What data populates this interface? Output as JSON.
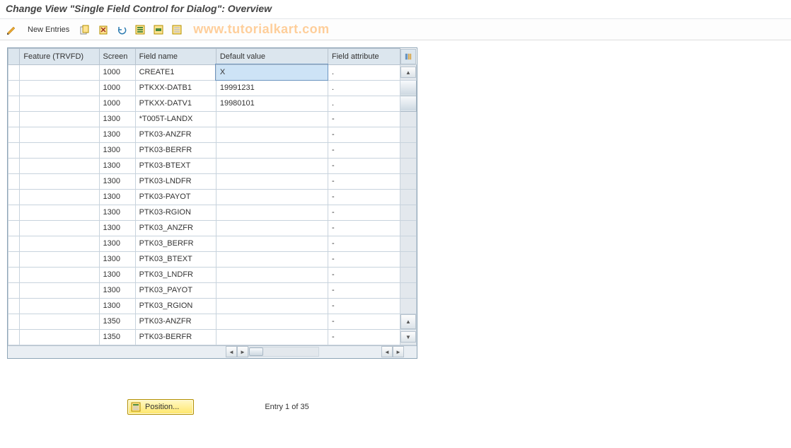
{
  "title": "Change View \"Single Field Control for Dialog\": Overview",
  "watermark": "www.tutorialkart.com",
  "toolbar": {
    "new_entries": "New Entries"
  },
  "columns": {
    "feature": "Feature (TRVFD)",
    "screen": "Screen",
    "field_name": "Field name",
    "default_value": "Default value",
    "field_attr": "Field attribute"
  },
  "rows": [
    {
      "feature": "",
      "screen": "1000",
      "field_name": "CREATE1",
      "default": "X",
      "attr": "."
    },
    {
      "feature": "",
      "screen": "1000",
      "field_name": "PTKXX-DATB1",
      "default": "19991231",
      "attr": "."
    },
    {
      "feature": "",
      "screen": "1000",
      "field_name": "PTKXX-DATV1",
      "default": "19980101",
      "attr": "."
    },
    {
      "feature": "",
      "screen": "1300",
      "field_name": "*T005T-LANDX",
      "default": "",
      "attr": "-"
    },
    {
      "feature": "",
      "screen": "1300",
      "field_name": "PTK03-ANZFR",
      "default": "",
      "attr": "-"
    },
    {
      "feature": "",
      "screen": "1300",
      "field_name": "PTK03-BERFR",
      "default": "",
      "attr": "-"
    },
    {
      "feature": "",
      "screen": "1300",
      "field_name": "PTK03-BTEXT",
      "default": "",
      "attr": "-"
    },
    {
      "feature": "",
      "screen": "1300",
      "field_name": "PTK03-LNDFR",
      "default": "",
      "attr": "-"
    },
    {
      "feature": "",
      "screen": "1300",
      "field_name": "PTK03-PAYOT",
      "default": "",
      "attr": "-"
    },
    {
      "feature": "",
      "screen": "1300",
      "field_name": "PTK03-RGION",
      "default": "",
      "attr": "-"
    },
    {
      "feature": "",
      "screen": "1300",
      "field_name": "PTK03_ANZFR",
      "default": "",
      "attr": "-"
    },
    {
      "feature": "",
      "screen": "1300",
      "field_name": "PTK03_BERFR",
      "default": "",
      "attr": "-"
    },
    {
      "feature": "",
      "screen": "1300",
      "field_name": "PTK03_BTEXT",
      "default": "",
      "attr": "-"
    },
    {
      "feature": "",
      "screen": "1300",
      "field_name": "PTK03_LNDFR",
      "default": "",
      "attr": "-"
    },
    {
      "feature": "",
      "screen": "1300",
      "field_name": "PTK03_PAYOT",
      "default": "",
      "attr": "-"
    },
    {
      "feature": "",
      "screen": "1300",
      "field_name": "PTK03_RGION",
      "default": "",
      "attr": "-"
    },
    {
      "feature": "",
      "screen": "1350",
      "field_name": "PTK03-ANZFR",
      "default": "",
      "attr": "-"
    },
    {
      "feature": "",
      "screen": "1350",
      "field_name": "PTK03-BERFR",
      "default": "",
      "attr": "-"
    }
  ],
  "footer": {
    "position_btn": "Position...",
    "entry_text": "Entry 1 of 35"
  }
}
